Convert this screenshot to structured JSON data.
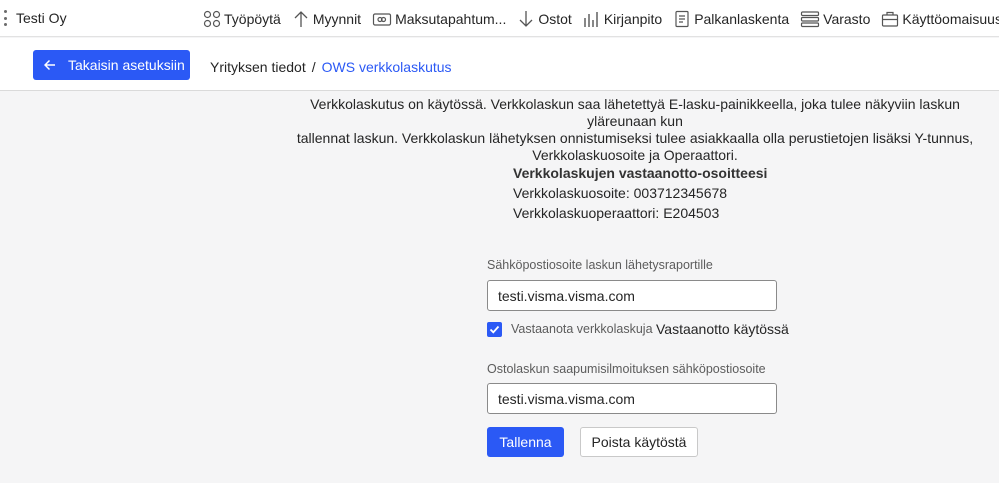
{
  "topbar": {
    "company": "Testi Oy",
    "nav": [
      {
        "label": "Työpöytä",
        "icon": "dashboard-icon"
      },
      {
        "label": "Myynnit",
        "icon": "arrow-up-icon"
      },
      {
        "label": "Maksutapahtum...",
        "icon": "card-icon"
      },
      {
        "label": "Ostot",
        "icon": "arrow-down-icon"
      },
      {
        "label": "Kirjanpito",
        "icon": "bar-chart-icon"
      },
      {
        "label": "Palkanlaskenta",
        "icon": "document-icon"
      },
      {
        "label": "Varasto",
        "icon": "layers-icon"
      },
      {
        "label": "Käyttöomaisuus",
        "icon": "briefcase-icon"
      }
    ]
  },
  "subbar": {
    "back_label": "Takaisin asetuksiin",
    "breadcrumb_parent": "Yrityksen tiedot",
    "breadcrumb_sep": "/",
    "breadcrumb_current": "OWS verkkolaskutus"
  },
  "content": {
    "intro_line1": "Verkkolaskutus on käytössä. Verkkolaskun saa lähetettyä E-lasku-painikkeella, joka tulee näkyviin laskun yläreunaan kun",
    "intro_line2": "tallennat laskun. Verkkolaskun lähetyksen onnistumiseksi tulee asiakkaalla olla perustietojen lisäksi Y-tunnus,",
    "intro_line3": "Verkkolaskuosoite ja Operaattori.",
    "addresses_heading": "Verkkolaskujen vastaanotto-osoitteesi",
    "address_line": "Verkkolaskuosoite: 003712345678",
    "operator_line": "Verkkolaskuoperaattori: E204503",
    "report_email_label": "Sähköpostiosoite laskun lähetysraportille",
    "report_email_value": "testi.visma.visma.com",
    "receive_checkbox_label": "Vastaanota verkkolaskuja",
    "receive_checked": true,
    "receive_status": "Vastaanotto käytössä",
    "notify_email_label": "Ostolaskun saapumisilmoituksen sähköpostiosoite",
    "notify_email_value": "testi.visma.visma.com",
    "save_label": "Tallenna",
    "remove_label": "Poista käytöstä"
  },
  "colors": {
    "accent": "#2b59f5",
    "background": "#f5f5f6"
  }
}
